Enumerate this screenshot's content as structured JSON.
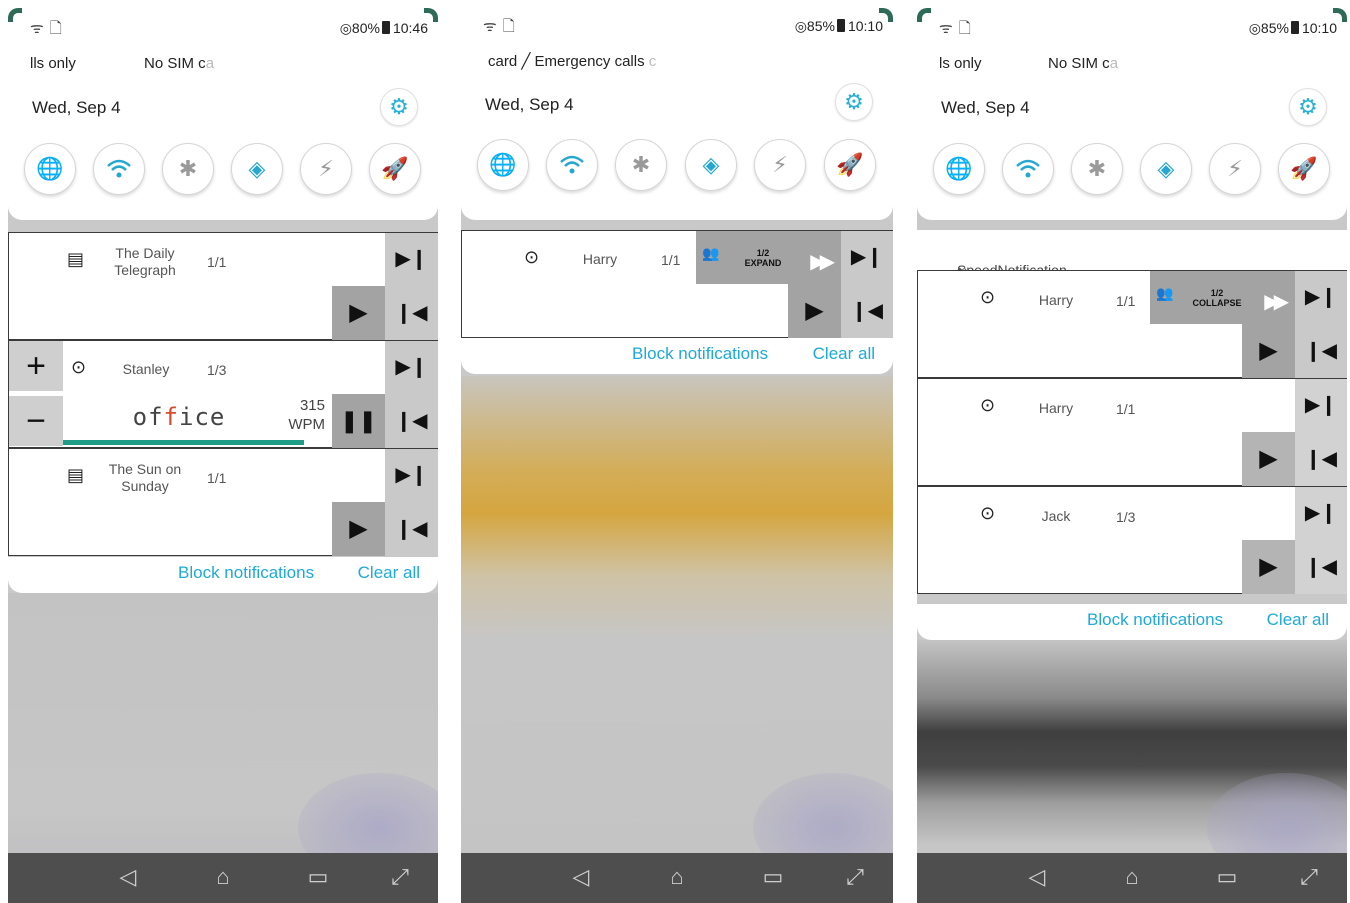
{
  "panels": [
    {
      "status": {
        "signal_icons": "ᯤ🗋",
        "battery": "80%",
        "time": "10:46"
      },
      "carrier": {
        "left": "lls only",
        "right": "No SIM c",
        "right_fade": "a"
      },
      "date": "Wed, Sep 4",
      "notifications": [
        {
          "icon": "newspaper-icon",
          "title": "The Daily Telegraph",
          "count": "1/1"
        },
        {
          "icon": "messenger-icon",
          "title": "Stanley",
          "count": "1/3",
          "word_pre": "of",
          "word_hl": "f",
          "word_post": "ice",
          "wpm_value": "315",
          "wpm_unit": "WPM",
          "progress": 0.86
        },
        {
          "icon": "newspaper-icon",
          "title": "The Sun on Sunday",
          "count": "1/1"
        }
      ],
      "actions": {
        "block": "Block notifications",
        "clear": "Clear all"
      }
    },
    {
      "status": {
        "signal_icons": "ᯤ🗋",
        "battery": "85%",
        "time": "10:10"
      },
      "carrier": {
        "left": "card ╱ Emergency calls ",
        "right": "",
        "right_fade": "c"
      },
      "date": "Wed, Sep 4",
      "notifications": [
        {
          "icon": "messenger-icon",
          "title": "Harry",
          "count": "1/1",
          "group_count": "1/2",
          "group_action": "EXPAND"
        }
      ],
      "actions": {
        "block": "Block notifications",
        "clear": "Clear all"
      }
    },
    {
      "status": {
        "signal_icons": "ᯤ🗋",
        "battery": "85%",
        "time": "10:10"
      },
      "carrier": {
        "left": "ls only",
        "right": "No SIM c",
        "right_fade": "a"
      },
      "date": "Wed, Sep 4",
      "group_header": "SpeedNotification ˄",
      "notifications": [
        {
          "icon": "messenger-icon",
          "title": "Harry",
          "count": "1/1",
          "group_count": "1/2",
          "group_action": "COLLAPSE"
        },
        {
          "icon": "messenger-icon",
          "title": "Harry",
          "count": "1/1"
        },
        {
          "icon": "messenger-icon",
          "title": "Jack",
          "count": "1/3"
        }
      ],
      "actions": {
        "block": "Block notifications",
        "clear": "Clear all"
      }
    }
  ],
  "glyphs": {
    "gear": "⚙",
    "globe": "🌐",
    "wifi": "◠",
    "bluetooth_off": "✱",
    "rotate": "◈",
    "flash_off": "⚡",
    "rocket": "🚀",
    "next": "▶❙",
    "prev": "❙◀",
    "play": "▶",
    "pause": "❚❚",
    "plus": "+",
    "minus": "−",
    "newspaper": "▤",
    "messenger": "⊙",
    "people": "👥",
    "fast_forward": "▶▶",
    "infinity": "∞",
    "nav_back": "◁",
    "nav_home": "⌂",
    "nav_recent": "▭",
    "nav_expand": "⤢"
  }
}
